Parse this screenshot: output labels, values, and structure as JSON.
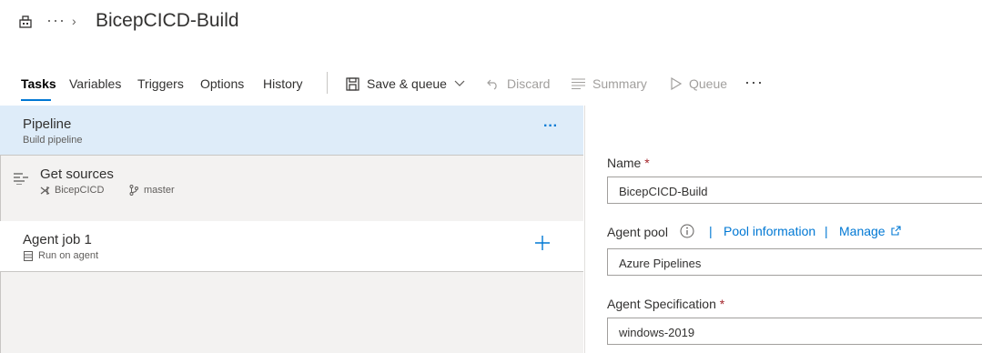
{
  "header": {
    "title": "BicepCICD-Build",
    "more": "···",
    "chevron": "›"
  },
  "tabs": [
    {
      "label": "Tasks",
      "active": true
    },
    {
      "label": "Variables"
    },
    {
      "label": "Triggers"
    },
    {
      "label": "Options"
    },
    {
      "label": "History"
    }
  ],
  "toolbar": {
    "save_queue": "Save & queue",
    "discard": "Discard",
    "summary": "Summary",
    "queue": "Queue",
    "more": "···"
  },
  "left": {
    "pipeline": {
      "title": "Pipeline",
      "subtitle": "Build pipeline",
      "more": "···"
    },
    "get_sources": {
      "title": "Get sources",
      "repo": "BicepCICD",
      "branch": "master"
    },
    "agent_job": {
      "title": "Agent job 1",
      "subtitle": "Run on agent",
      "add": "+"
    }
  },
  "right": {
    "name_label": "Name",
    "name_value": "BicepCICD-Build",
    "agent_pool_label": "Agent pool",
    "pool_information": "Pool information",
    "manage": "Manage",
    "agent_pool_value": "Azure Pipelines",
    "agent_spec_label": "Agent Specification",
    "agent_spec_value": "windows-2019",
    "required_mark": "*",
    "separator": "|"
  },
  "colors": {
    "accent": "#0078d4",
    "selected_row": "#deecf9",
    "required": "#a4262c"
  }
}
